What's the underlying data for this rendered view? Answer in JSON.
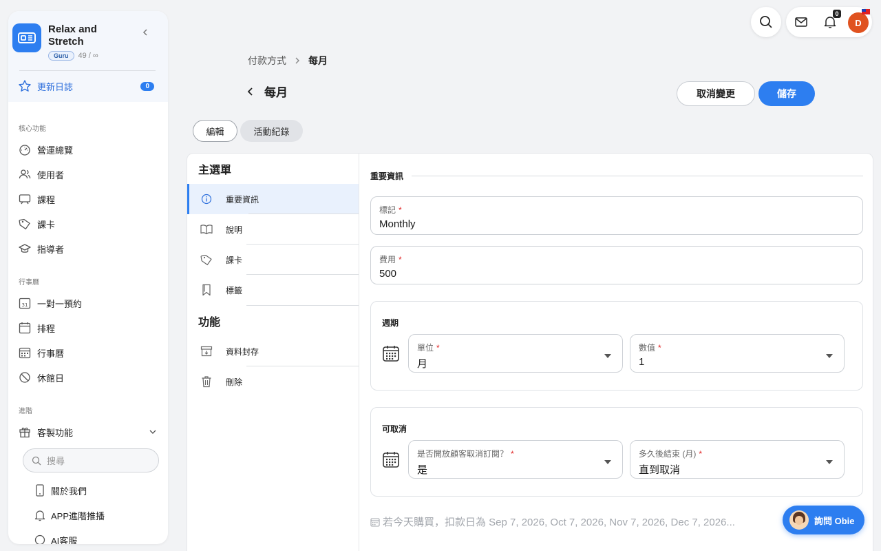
{
  "app": {
    "name": "Relax and Stretch",
    "plan_badge": "Guru",
    "plan_count": "49 / ∞",
    "brand_color": "#2d7ef0"
  },
  "sidebar": {
    "changelog_label": "更新日誌",
    "changelog_count": "0",
    "sections": [
      {
        "title": "核心功能",
        "items": [
          {
            "label": "營運總覽",
            "icon": "dashboard-icon"
          },
          {
            "label": "使用者",
            "icon": "users-icon"
          },
          {
            "label": "課程",
            "icon": "course-icon"
          },
          {
            "label": "課卡",
            "icon": "tag-icon"
          },
          {
            "label": "指導者",
            "icon": "graduation-cap-icon"
          }
        ]
      },
      {
        "title": "行事曆",
        "items": [
          {
            "label": "一對一預約",
            "icon": "calendar-31-icon"
          },
          {
            "label": "排程",
            "icon": "calendar-icon"
          },
          {
            "label": "行事曆",
            "icon": "calendar-grid-icon"
          },
          {
            "label": "休館日",
            "icon": "ban-icon"
          }
        ]
      },
      {
        "title": "進階",
        "items": [
          {
            "label": "客製功能",
            "icon": "gift-icon"
          }
        ]
      }
    ],
    "search_placeholder": "搜尋",
    "sub_items": [
      {
        "label": "關於我們",
        "icon": "phone-icon"
      },
      {
        "label": "APP進階推播",
        "icon": "bell-icon"
      },
      {
        "label": "AI客服",
        "icon": "chat-icon"
      }
    ]
  },
  "topbar": {
    "notification_count": "0",
    "avatar_initial": "D"
  },
  "breadcrumb": {
    "parent": "付款方式",
    "current": "每月"
  },
  "page": {
    "title": "每月",
    "cancel_label": "取消變更",
    "save_label": "儲存"
  },
  "tabs": [
    {
      "label": "編輯",
      "active": true
    },
    {
      "label": "活動紀錄",
      "active": false
    }
  ],
  "menu": {
    "main_heading": "主選單",
    "main_items": [
      {
        "label": "重要資訊",
        "icon": "info-icon",
        "active": true
      },
      {
        "label": "說明",
        "icon": "book-icon"
      },
      {
        "label": "課卡",
        "icon": "tag-icon"
      },
      {
        "label": "標籤",
        "icon": "bookmark-icon"
      }
    ],
    "func_heading": "功能",
    "func_items": [
      {
        "label": "資料封存",
        "icon": "archive-icon"
      },
      {
        "label": "刪除",
        "icon": "trash-icon"
      }
    ]
  },
  "form": {
    "section_title": "重要資訊",
    "label_field": {
      "label": "標記",
      "value": "Monthly"
    },
    "price_field": {
      "label": "費用",
      "value": "500"
    },
    "period": {
      "title": "週期",
      "unit": {
        "label": "單位",
        "value": "月"
      },
      "count": {
        "label": "數值",
        "value": "1"
      }
    },
    "cancellable": {
      "title": "可取消",
      "allow": {
        "label": "是否開放顧客取消訂閱？",
        "value": "是"
      },
      "end": {
        "label": "多久後結束 (月)",
        "value": "直到取消"
      }
    },
    "note": "若今天購買，扣款日為 Sep 7, 2026, Oct 7, 2026, Nov 7, 2026, Dec 7, 2026..."
  },
  "assistant": {
    "label": "詢問 Obie"
  }
}
